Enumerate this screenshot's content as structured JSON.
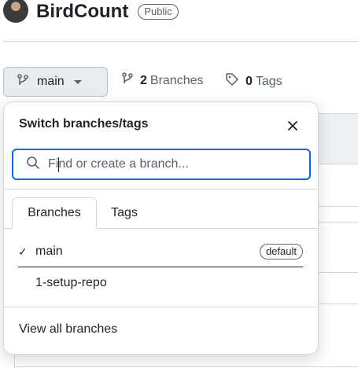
{
  "repo": {
    "name": "BirdCount",
    "visibility": "Public"
  },
  "toolbar": {
    "current_branch": "main",
    "branches_count": "2",
    "branches_label": "Branches",
    "tags_count": "0",
    "tags_label": "Tags"
  },
  "popover": {
    "title": "Switch branches/tags",
    "search_placeholder": "Find or create a branch...",
    "tabs": [
      {
        "label": "Branches",
        "active": true
      },
      {
        "label": "Tags",
        "active": false
      }
    ],
    "branches": [
      {
        "name": "main",
        "selected": true,
        "badge": "default"
      },
      {
        "name": "1-setup-repo",
        "selected": false,
        "badge": ""
      }
    ],
    "check_glyph": "✓",
    "footer_link": "View all branches"
  },
  "icons": {
    "branch": "git-branch-icon",
    "tag": "tag-icon",
    "search": "search-icon",
    "close": "close-icon",
    "caret": "triangle-down-icon"
  },
  "colors": {
    "accent": "#0969da",
    "text": "#1f2328",
    "muted": "#59636e",
    "border": "#d1d9e0",
    "button_bg": "#e8ecf0"
  }
}
